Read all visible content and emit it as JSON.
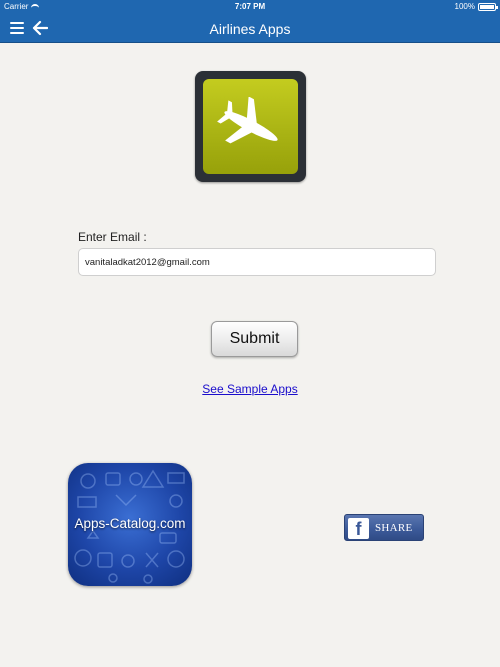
{
  "status_bar": {
    "carrier": "Carrier",
    "time": "7:07 PM",
    "battery": "100%"
  },
  "nav": {
    "title": "Airlines Apps"
  },
  "form": {
    "email_label": "Enter Email :",
    "email_value": "vanitaladkat2012@gmail.com",
    "submit_label": "Submit"
  },
  "link": {
    "sample_apps": "See Sample Apps "
  },
  "catalog": {
    "label": "Apps-Catalog.com"
  },
  "share": {
    "label": "SHARE",
    "fb_letter": "f"
  },
  "colors": {
    "nav_bg": "#1f67b0",
    "app_icon_green": "#aab414",
    "link": "#1a0dcc",
    "facebook": "#3b5998"
  },
  "icons": [
    "menu-icon",
    "back-arrow-icon",
    "airplane-icon",
    "facebook-icon"
  ]
}
